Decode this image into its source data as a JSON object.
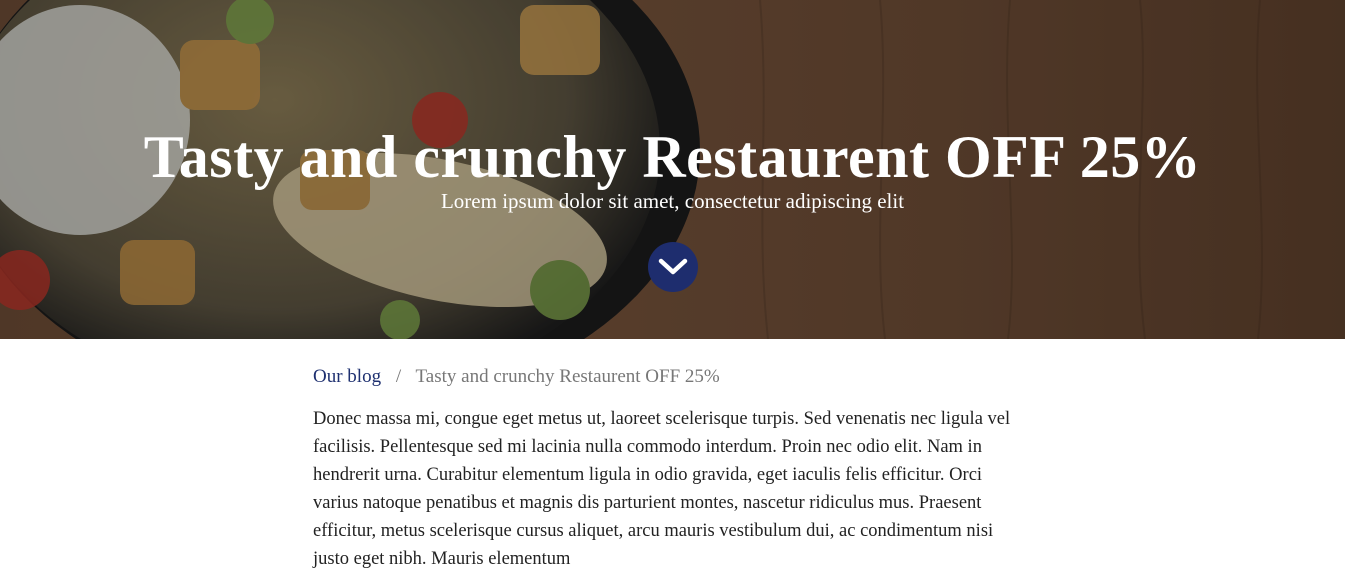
{
  "hero": {
    "title": "Tasty and crunchy Restaurent OFF 25%",
    "subtitle": "Lorem ipsum dolor sit amet, consectetur adipiscing elit",
    "scroll_icon": "chevron-down-icon",
    "button_color": "#1e2d6e"
  },
  "breadcrumb": {
    "parent": "Our blog",
    "separator": "/",
    "current": "Tasty and crunchy Restaurent OFF 25%"
  },
  "article": {
    "body": "Donec massa mi, congue eget metus ut, laoreet scelerisque turpis. Sed venenatis nec ligula vel facilisis. Pellentesque sed mi lacinia nulla commodo interdum. Proin nec odio elit. Nam in hendrerit urna. Curabitur elementum ligula in odio gravida, eget iaculis felis efficitur. Orci varius natoque penatibus et magnis dis parturient montes, nascetur ridiculus mus. Praesent efficitur, metus scelerisque cursus aliquet, arcu mauris vestibulum dui, ac condimentum nisi justo eget nibh. Mauris elementum"
  },
  "colors": {
    "link": "#1e3070",
    "muted": "#777777",
    "text": "#222222"
  }
}
